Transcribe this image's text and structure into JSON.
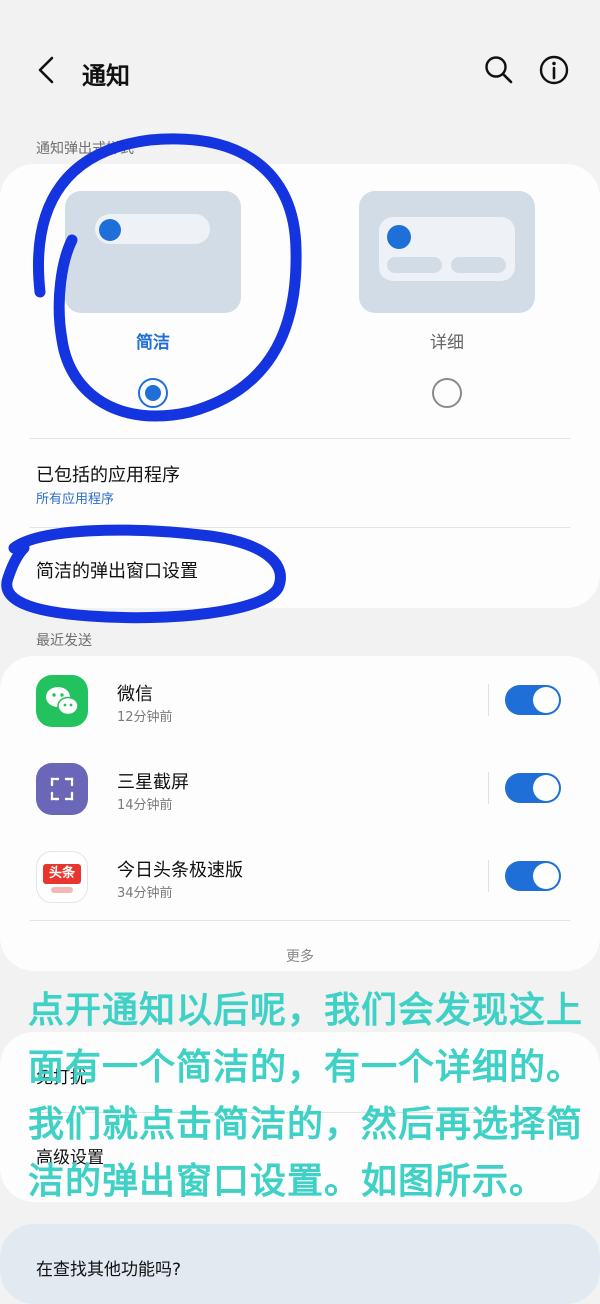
{
  "header": {
    "title": "通知",
    "icons": [
      "back-icon",
      "search-icon",
      "info-icon"
    ]
  },
  "popup_section": {
    "label": "通知弹出式样式",
    "options": [
      {
        "label": "简洁",
        "selected": true
      },
      {
        "label": "详细",
        "selected": false
      }
    ],
    "included_apps_title": "已包括的应用程序",
    "included_apps_value": "所有应用程序",
    "brief_settings": "简洁的弹出窗口设置"
  },
  "recent_section": {
    "label": "最近发送",
    "apps": [
      {
        "name": "微信",
        "time": "12分钟前",
        "icon": "wechat-icon",
        "enabled": true
      },
      {
        "name": "三星截屏",
        "time": "14分钟前",
        "icon": "screenshot-icon",
        "enabled": true
      },
      {
        "name": "今日头条极速版",
        "time": "34分钟前",
        "icon": "toutiao-icon",
        "icon_text": "头条",
        "enabled": true
      }
    ],
    "more": "更多"
  },
  "other": {
    "dnd": "免打扰",
    "advanced": "高级设置",
    "looking": "在查找其他功能吗?"
  },
  "overlay_caption": "点开通知以后呢，我们会发现这上面有一个简洁的，有一个详细的。我们就点击简洁的，然后再选择简洁的弹出窗口设置。如图所示。",
  "colors": {
    "accent": "#1f6fd8",
    "caption": "#3fd1c6",
    "annotation": "#1434e0"
  }
}
